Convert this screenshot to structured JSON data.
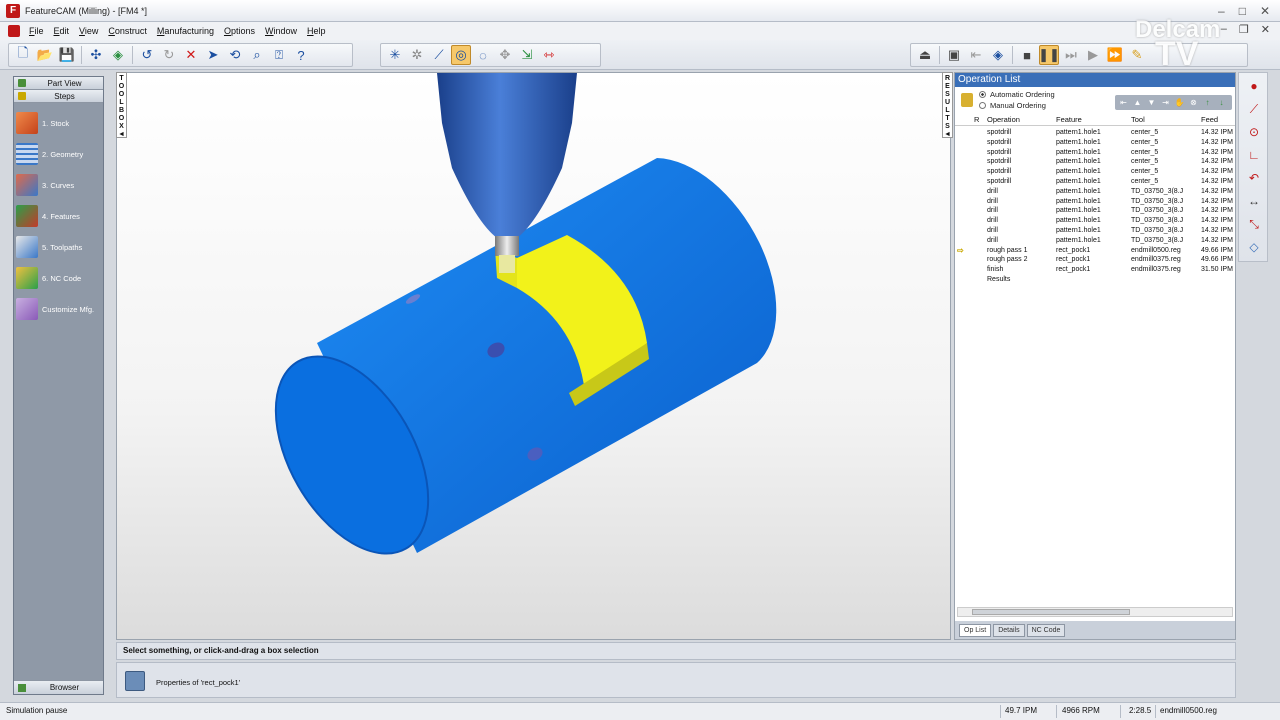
{
  "window": {
    "title": "FeatureCAM (Milling) - [FM4 *]",
    "app_icon": "F"
  },
  "menu": [
    "File",
    "Edit",
    "View",
    "Construct",
    "Manufacturing",
    "Options",
    "Window",
    "Help"
  ],
  "left_panel": {
    "part_view": "Part View",
    "steps_header": "Steps",
    "steps": [
      {
        "label": "1.   Stock",
        "icon": "stock-icon",
        "color": "#c4421a"
      },
      {
        "label": "2.   Geometry",
        "icon": "geometry-icon",
        "color": "#3a78c8"
      },
      {
        "label": "3.   Curves",
        "icon": "curves-icon",
        "color": "#c43a2a"
      },
      {
        "label": "4.   Features",
        "icon": "features-icon",
        "color": "#2aa04a"
      },
      {
        "label": "5.   Toolpaths",
        "icon": "toolpaths-icon",
        "color": "#3a78c8"
      },
      {
        "label": "6.   NC Code",
        "icon": "nc-code-icon",
        "color": "#e8a020"
      },
      {
        "label": "Customize Mfg.",
        "icon": "customize-icon",
        "color": "#8a5ab8"
      }
    ],
    "browser": "Browser"
  },
  "toolbox_label": [
    "T",
    "O",
    "O",
    "L",
    "B",
    "O",
    "X",
    "◄"
  ],
  "results_label": [
    "R",
    "E",
    "S",
    "U",
    "L",
    "T",
    "S",
    "◄"
  ],
  "operation_list": {
    "title": "Operation List",
    "ordering": [
      {
        "label": "Automatic Ordering",
        "selected": true
      },
      {
        "label": "Manual Ordering",
        "selected": false
      }
    ],
    "columns": {
      "r": "R",
      "operation": "Operation",
      "feature": "Feature",
      "tool": "Tool",
      "feed": "Feed"
    },
    "rows": [
      {
        "operation": "spotdrill",
        "feature": "pattern1.hole1",
        "tool": "center_5",
        "feed": "14.32 IPM",
        "current": false
      },
      {
        "operation": "spotdrill",
        "feature": "pattern1.hole1",
        "tool": "center_5",
        "feed": "14.32 IPM",
        "current": false
      },
      {
        "operation": "spotdrill",
        "feature": "pattern1.hole1",
        "tool": "center_5",
        "feed": "14.32 IPM",
        "current": false
      },
      {
        "operation": "spotdrill",
        "feature": "pattern1.hole1",
        "tool": "center_5",
        "feed": "14.32 IPM",
        "current": false
      },
      {
        "operation": "spotdrill",
        "feature": "pattern1.hole1",
        "tool": "center_5",
        "feed": "14.32 IPM",
        "current": false
      },
      {
        "operation": "spotdrill",
        "feature": "pattern1.hole1",
        "tool": "center_5",
        "feed": "14.32 IPM",
        "current": false
      },
      {
        "operation": "drill",
        "feature": "pattern1.hole1",
        "tool": "TD_03750_3(8.J",
        "feed": "14.32 IPM",
        "current": false
      },
      {
        "operation": "drill",
        "feature": "pattern1.hole1",
        "tool": "TD_03750_3(8.J",
        "feed": "14.32 IPM",
        "current": false
      },
      {
        "operation": "drill",
        "feature": "pattern1.hole1",
        "tool": "TD_03750_3(8.J",
        "feed": "14.32 IPM",
        "current": false
      },
      {
        "operation": "drill",
        "feature": "pattern1.hole1",
        "tool": "TD_03750_3(8.J",
        "feed": "14.32 IPM",
        "current": false
      },
      {
        "operation": "drill",
        "feature": "pattern1.hole1",
        "tool": "TD_03750_3(8.J",
        "feed": "14.32 IPM",
        "current": false
      },
      {
        "operation": "drill",
        "feature": "pattern1.hole1",
        "tool": "TD_03750_3(8.J",
        "feed": "14.32 IPM",
        "current": false
      },
      {
        "operation": "rough pass 1",
        "feature": "rect_pock1",
        "tool": "endmill0500.reg",
        "feed": "49.66 IPM",
        "current": true
      },
      {
        "operation": "rough pass 2",
        "feature": "rect_pock1",
        "tool": "endmill0375.reg",
        "feed": "49.66 IPM",
        "current": false
      },
      {
        "operation": "finish",
        "feature": "rect_pock1",
        "tool": "endmill0375.reg",
        "feed": "31.50 IPM",
        "current": false
      },
      {
        "operation": "Results",
        "feature": "",
        "tool": "",
        "feed": "",
        "current": false
      }
    ],
    "tabs": [
      {
        "label": "Op List",
        "active": true
      },
      {
        "label": "Details",
        "active": false
      },
      {
        "label": "NC Code",
        "active": false
      }
    ]
  },
  "prompt": "Select something, or click-and-drag a box selection",
  "properties_text": "Properties of 'rect_pock1'",
  "status": {
    "left": "Simulation pause",
    "feed": "49.7 IPM",
    "speed": "4966 RPM",
    "time": "2:28.5",
    "tool": "endmill0500.reg"
  },
  "watermark": {
    "line1": "Delcam",
    "line2": "TV"
  },
  "colors": {
    "part_blue": "#0a6fe0",
    "pocket_yellow": "#f2f21a",
    "accent": "#3a6fb8"
  }
}
